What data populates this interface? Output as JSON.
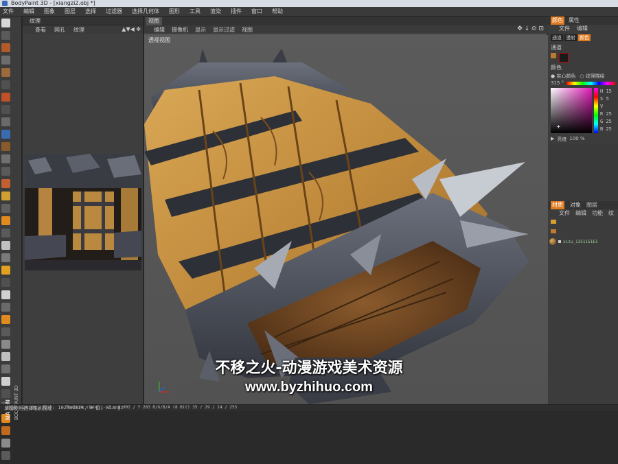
{
  "window": {
    "title": "BodyPaint 3D - [xiangzi2.obj *]"
  },
  "menubar": [
    "文件",
    "编辑",
    "图象",
    "图层",
    "选择",
    "过滤器",
    "选择几何体",
    "图形",
    "工具",
    "渲染",
    "插件",
    "窗口",
    "帮助"
  ],
  "texture_panel": {
    "title": "纹理",
    "menu": [
      "查看",
      "网孔",
      "纹理"
    ]
  },
  "viewport": {
    "tab": "视图",
    "menu": [
      "编辑",
      "摄像机",
      "显示",
      "显示过滤",
      "视图"
    ],
    "label": "透视视图",
    "nav_icons": "✥ ↓ ⊙ ⊡"
  },
  "right_panel": {
    "tabs": [
      "颜色",
      "属性"
    ],
    "menu": [
      "文件",
      "编辑"
    ],
    "swatch_labels": [
      "通道",
      "漫射",
      "颜色"
    ],
    "channel_label": "通道",
    "color_label": "颜色",
    "color_options": [
      "实心颜色",
      "纹理描绘"
    ],
    "hue_value": "315 °",
    "channel_letters": [
      "H",
      "S",
      "V",
      "R",
      "G",
      "B"
    ],
    "channel_values": [
      "15",
      "5",
      "",
      "25",
      "25",
      "25"
    ],
    "brightness_label": "亮度",
    "brightness_value": "100 %",
    "objects_tabs": [
      "材质",
      "对象",
      "图层"
    ],
    "objects_menu": [
      "文件",
      "编辑",
      "功能",
      "纹"
    ],
    "material_name": "xizu_1351151E1"
  },
  "statusbar": {
    "left": "缩放: 24.6%, 尺寸: 1024x1024, 8 位, xiangz",
    "help": "单击使用选择笔刷描绘",
    "texture": "Texture xiangzi-s2 : X 902 / Y 283 R/G/B/A (8 Bit) 35 / 29 / 14 / 255"
  },
  "watermark": {
    "line1": "不移之火-动漫游戏美术资源",
    "line2": "www.byzhihuo.com"
  },
  "brand": "MAXON BODYPAINT 3D",
  "colors": {
    "wood": "#c4913f",
    "metal": "#4a4e57",
    "accent_orange": "#e07a1f",
    "bg": "#555555"
  }
}
